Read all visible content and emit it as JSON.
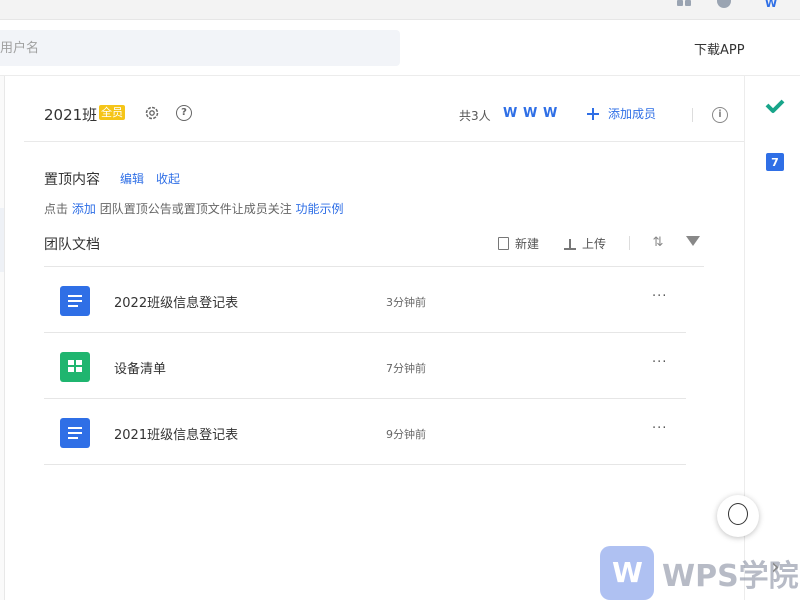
{
  "window": {
    "topbar_icons": [
      "grid-icon",
      "chat-icon",
      "wps-icon"
    ]
  },
  "header": {
    "search_placeholder": "用户名",
    "download_app": "下载APP"
  },
  "team": {
    "name": "2021班",
    "badge": "全员",
    "member_count_label": "共3人",
    "add_member_label": "添加成员"
  },
  "pinned": {
    "title": "置顶内容",
    "edit_label": "编辑",
    "collapse_label": "收起",
    "hint_prefix": "点击",
    "hint_add": "添加",
    "hint_middle": "团队置顶公告或置顶文件让成员关注",
    "hint_example": "功能示例"
  },
  "docs": {
    "title": "团队文档",
    "new_label": "新建",
    "upload_label": "上传",
    "items": [
      {
        "name": "2022班级信息登记表",
        "time": "3分钟前",
        "type": "doc"
      },
      {
        "name": "设备清单",
        "time": "7分钟前",
        "type": "sheet"
      },
      {
        "name": "2021班级信息登记表",
        "time": "9分钟前",
        "type": "doc"
      }
    ],
    "more_label": "···"
  },
  "rightbar": {
    "calendar_day": "7"
  },
  "watermark": {
    "text": "WPS学院"
  },
  "colors": {
    "accent": "#2f6fe6",
    "badge": "#f5c518",
    "sheet_green": "#1fb56f"
  }
}
